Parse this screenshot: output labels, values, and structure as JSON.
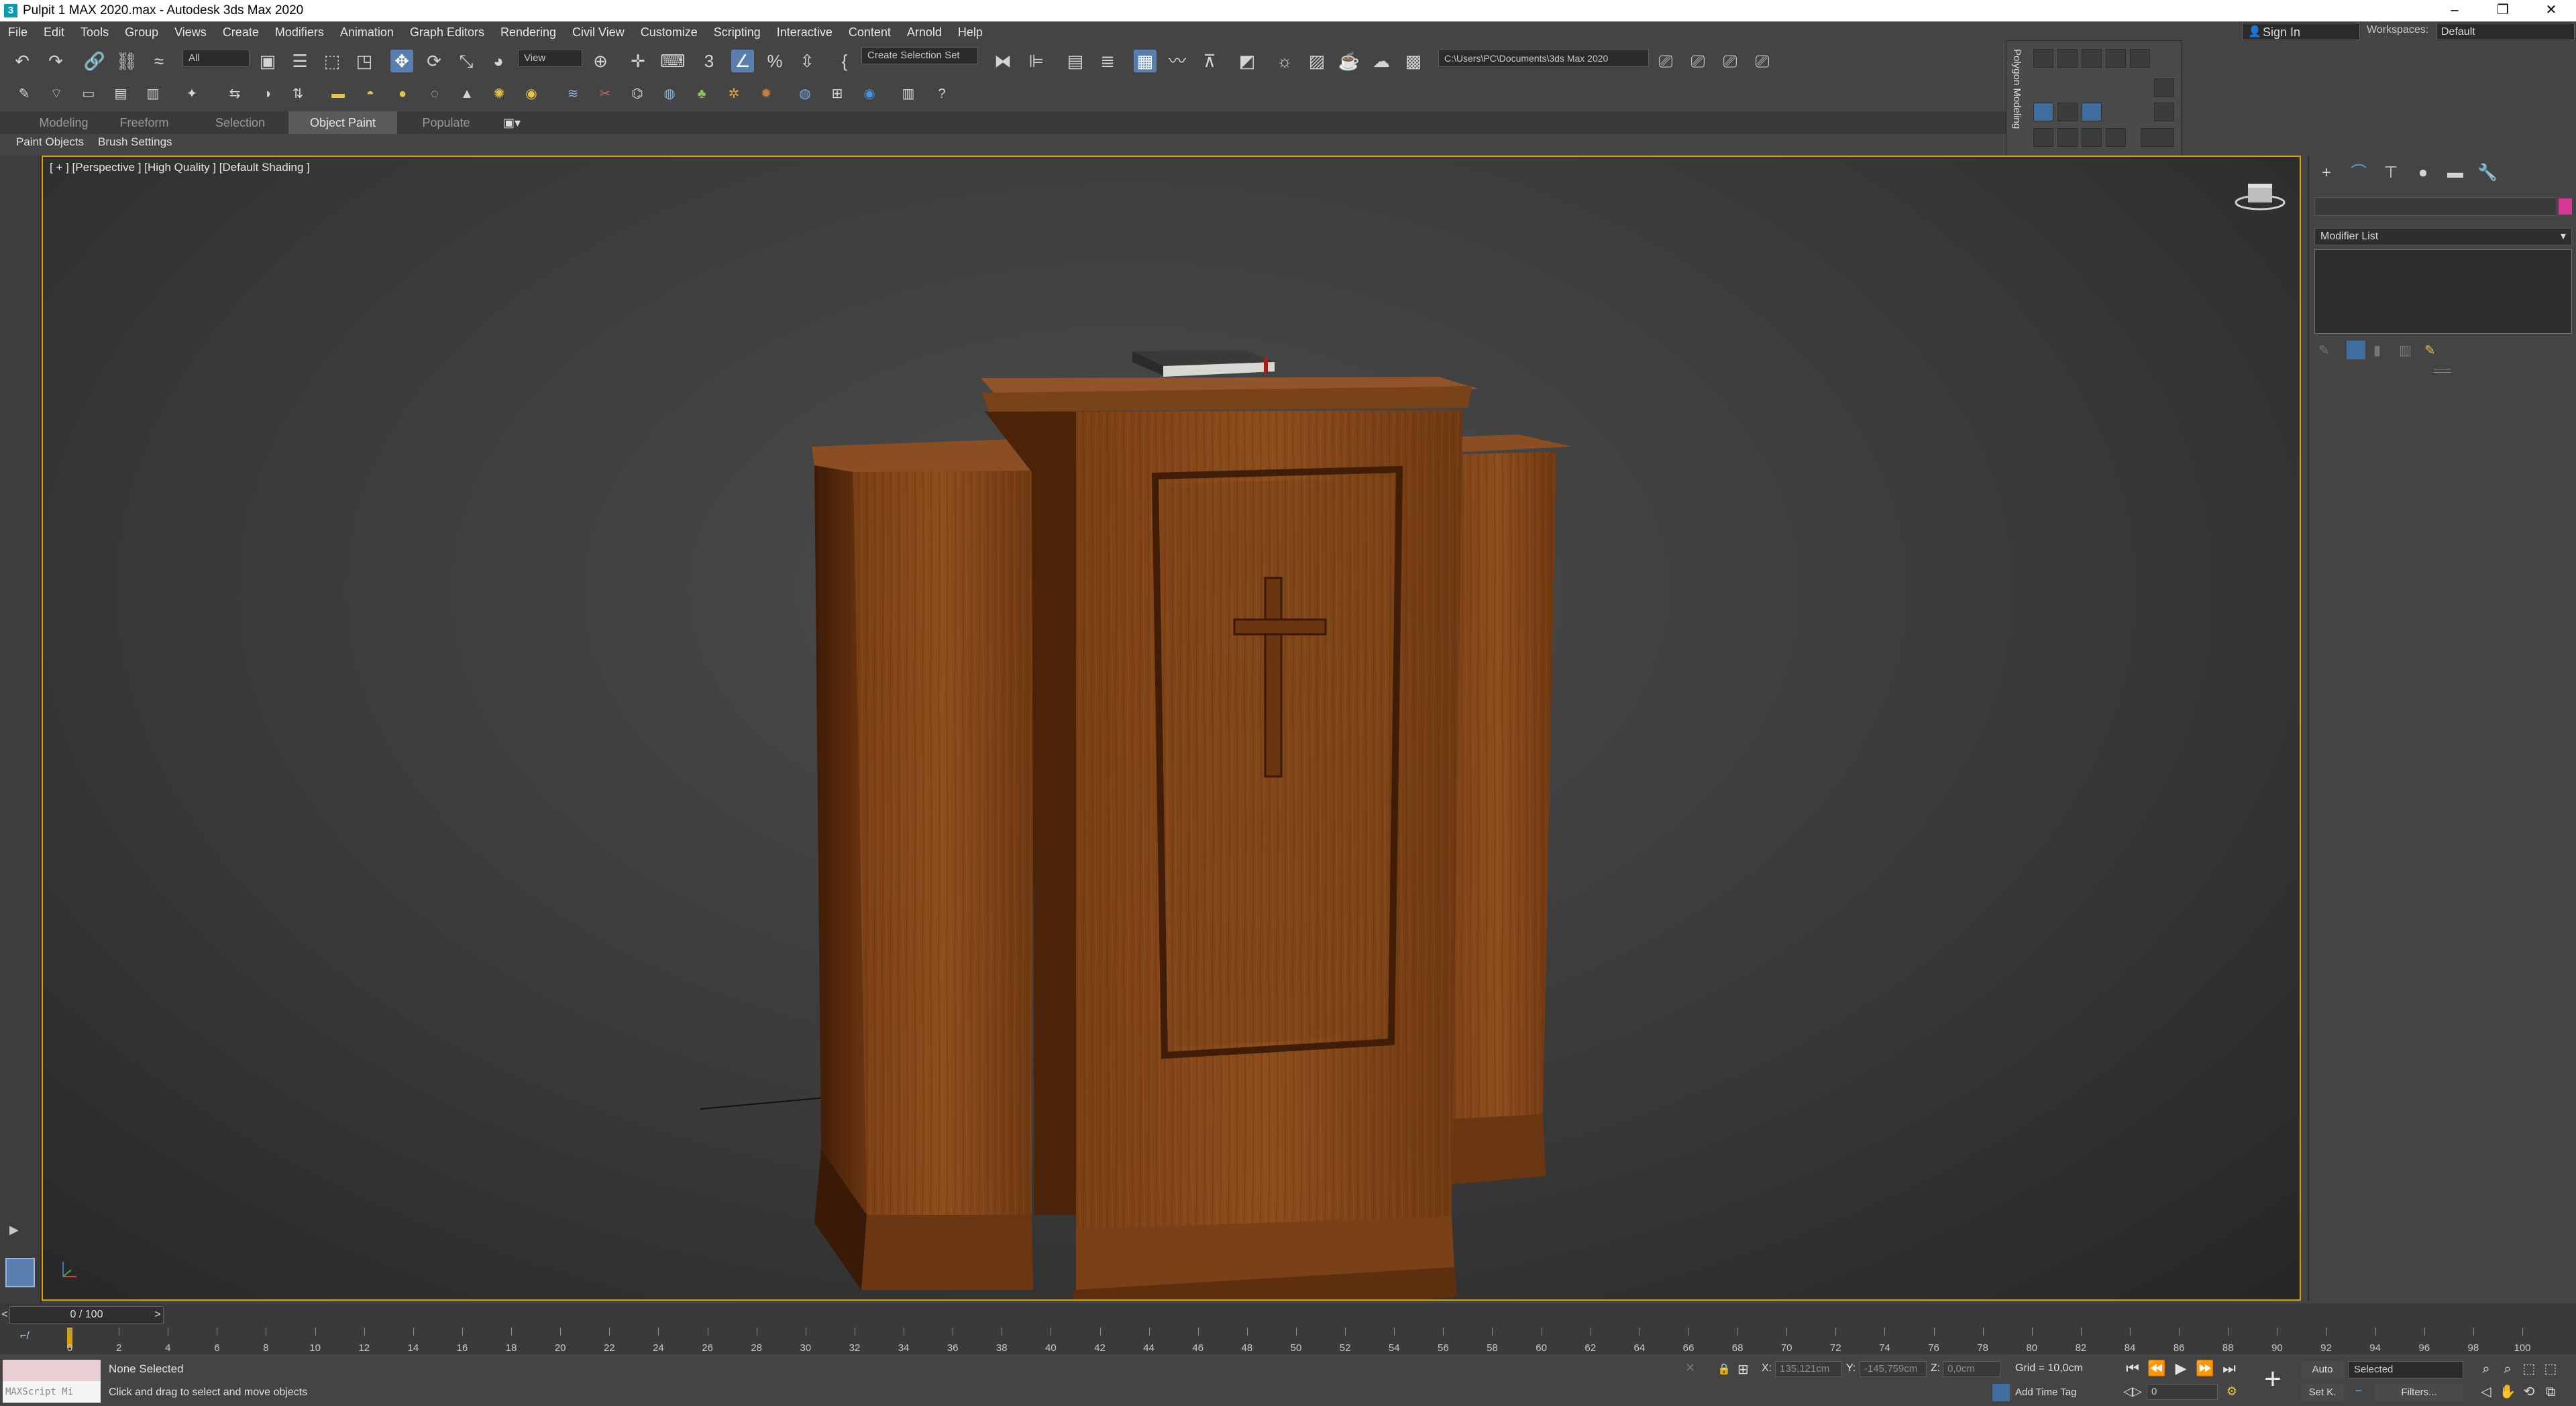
{
  "window": {
    "title": "Pulpit 1 MAX 2020.max - Autodesk 3ds Max 2020",
    "app_icon": "3"
  },
  "menubar": {
    "items": [
      "File",
      "Edit",
      "Tools",
      "Group",
      "Views",
      "Create",
      "Modifiers",
      "Animation",
      "Graph Editors",
      "Rendering",
      "Civil View",
      "Customize",
      "Scripting",
      "Interactive",
      "Content",
      "Arnold",
      "Help"
    ]
  },
  "account": {
    "sign_in": "Sign In",
    "workspaces_label": "Workspaces:",
    "workspace_value": "Default"
  },
  "toolbar": {
    "selection_filter": "All",
    "reference_coord": "View",
    "named_selection": "Create Selection Set",
    "project_path": "C:\\Users\\PC\\Documents\\3ds Max 2020",
    "snap_label": "3",
    "percent_snap": "%"
  },
  "ribbon": {
    "tabs": [
      "Modeling",
      "Freeform",
      "Selection",
      "Object Paint",
      "Populate"
    ],
    "active_tab": "Object Paint",
    "subtabs": [
      "Paint Objects",
      "Brush Settings"
    ]
  },
  "float_panel": {
    "title": "Polygon Modeling"
  },
  "viewport": {
    "label": "[ + ] [Perspective ] [High Quality ] [Default Shading ]"
  },
  "command_panel": {
    "modifier_list": "Modifier List",
    "color_swatch": "#d53894"
  },
  "timeline": {
    "frame": "0 / 100",
    "ticks": [
      0,
      2,
      4,
      6,
      8,
      10,
      12,
      14,
      16,
      18,
      20,
      22,
      24,
      26,
      28,
      30,
      32,
      34,
      36,
      38,
      40,
      42,
      44,
      46,
      48,
      50,
      52,
      54,
      56,
      58,
      60,
      62,
      64,
      66,
      68,
      70,
      72,
      74,
      76,
      78,
      80,
      82,
      84,
      86,
      88,
      90,
      92,
      94,
      96,
      98,
      100
    ]
  },
  "status": {
    "maxscript_placeholder": "MAXScript Mi",
    "selection": "None Selected",
    "prompt": "Click and drag to select and move objects",
    "x_label": "X:",
    "x_value": "135,121cm",
    "y_label": "Y:",
    "y_value": "-145,759cm",
    "z_label": "Z:",
    "z_value": "0,0cm",
    "grid": "Grid = 10,0cm",
    "add_time_tag": "Add Time Tag",
    "auto_key": "Auto",
    "set_key": "Set K.",
    "key_filter": "Selected",
    "filters": "Filters...",
    "current_frame": "0"
  }
}
